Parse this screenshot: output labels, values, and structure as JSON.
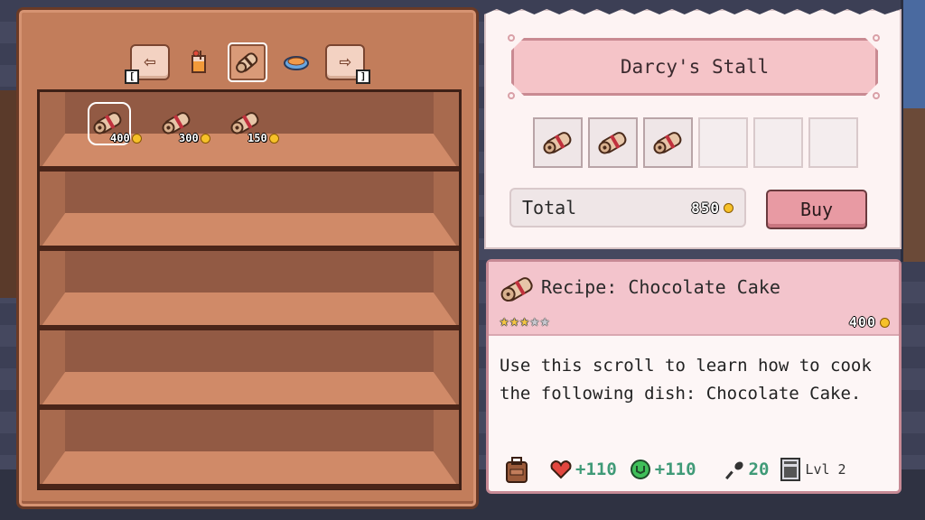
{
  "shelf": {
    "nav_left_key": "[",
    "nav_right_key": "]",
    "categories": [
      {
        "name": "drinks-icon"
      },
      {
        "name": "recipe-scroll-icon",
        "selected": true
      },
      {
        "name": "dish-icon"
      }
    ],
    "items": [
      {
        "price": "400",
        "selected": true
      },
      {
        "price": "300",
        "selected": false
      },
      {
        "price": "150",
        "selected": false
      }
    ]
  },
  "cart": {
    "stall_name": "Darcy's Stall",
    "slots": [
      true,
      true,
      true,
      false,
      false,
      false
    ],
    "total_label": "Total",
    "total_value": "850",
    "buy_label": "Buy"
  },
  "detail": {
    "title": "Recipe: Chocolate Cake",
    "stars_filled": 3,
    "stars_total": 5,
    "price": "400",
    "description": "Use this scroll to learn how to cook the following dish: Chocolate Cake.",
    "health": "+110",
    "energy": "+110",
    "time": "20",
    "level": "Lvl 2"
  },
  "colors": {
    "coin": "#f6c129",
    "stat_green": "#3f9a77",
    "buy_button": "#e89aa3"
  }
}
